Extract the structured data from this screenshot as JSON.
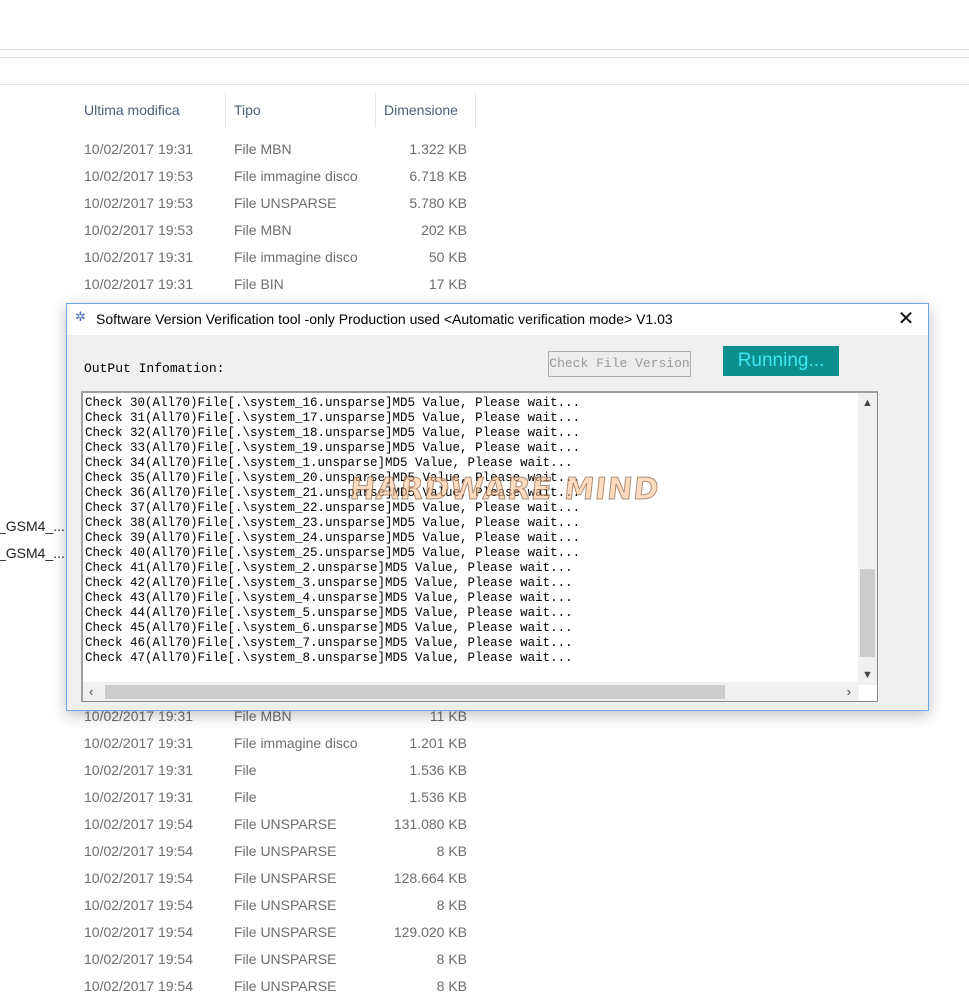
{
  "explorer": {
    "columns": {
      "date": "Ultima modifica",
      "type": "Tipo",
      "size": "Dimensione"
    },
    "name_fragments": [
      "_GSM4_...",
      "_GSM4_..."
    ],
    "rows_top": [
      {
        "date": "10/02/2017 19:31",
        "type": "File MBN",
        "size": "1.322 KB"
      },
      {
        "date": "10/02/2017 19:53",
        "type": "File immagine disco",
        "size": "6.718 KB"
      },
      {
        "date": "10/02/2017 19:53",
        "type": "File UNSPARSE",
        "size": "5.780 KB"
      },
      {
        "date": "10/02/2017 19:53",
        "type": "File MBN",
        "size": "202 KB"
      },
      {
        "date": "10/02/2017 19:31",
        "type": "File immagine disco",
        "size": "50 KB"
      },
      {
        "date": "10/02/2017 19:31",
        "type": "File BIN",
        "size": "17 KB"
      }
    ],
    "rows_bottom": [
      {
        "date": "10/02/2017 19:31",
        "type": "File MBN",
        "size": "11 KB"
      },
      {
        "date": "10/02/2017 19:31",
        "type": "File immagine disco",
        "size": "1.201 KB"
      },
      {
        "date": "10/02/2017 19:31",
        "type": "File",
        "size": "1.536 KB"
      },
      {
        "date": "10/02/2017 19:31",
        "type": "File",
        "size": "1.536 KB"
      },
      {
        "date": "10/02/2017 19:54",
        "type": "File UNSPARSE",
        "size": "131.080 KB"
      },
      {
        "date": "10/02/2017 19:54",
        "type": "File UNSPARSE",
        "size": "8 KB"
      },
      {
        "date": "10/02/2017 19:54",
        "type": "File UNSPARSE",
        "size": "128.664 KB"
      },
      {
        "date": "10/02/2017 19:54",
        "type": "File UNSPARSE",
        "size": "8 KB"
      },
      {
        "date": "10/02/2017 19:54",
        "type": "File UNSPARSE",
        "size": "129.020 KB"
      },
      {
        "date": "10/02/2017 19:54",
        "type": "File UNSPARSE",
        "size": "8 KB"
      },
      {
        "date": "10/02/2017 19:54",
        "type": "File UNSPARSE",
        "size": "8 KB"
      }
    ]
  },
  "dialog": {
    "title": "Software Version Verification tool -only Production used  <Automatic verification mode> V1.03",
    "close_label": "✕",
    "output_label": "OutPut Infomation:",
    "check_button": "Check File Version",
    "status": "Running...",
    "status_color": "#0b8f8f",
    "watermark": "HARDWARE MIND",
    "output_lines": [
      "Check 30(All70)File[.\\system_16.unsparse]MD5 Value, Please wait...",
      "Check 31(All70)File[.\\system_17.unsparse]MD5 Value, Please wait...",
      "Check 32(All70)File[.\\system_18.unsparse]MD5 Value, Please wait...",
      "Check 33(All70)File[.\\system_19.unsparse]MD5 Value, Please wait...",
      "Check 34(All70)File[.\\system_1.unsparse]MD5 Value, Please wait...",
      "Check 35(All70)File[.\\system_20.unsparse]MD5 Value, Please wait...",
      "Check 36(All70)File[.\\system_21.unsparse]MD5 Value, Please wait...",
      "Check 37(All70)File[.\\system_22.unsparse]MD5 Value, Please wait...",
      "Check 38(All70)File[.\\system_23.unsparse]MD5 Value, Please wait...",
      "Check 39(All70)File[.\\system_24.unsparse]MD5 Value, Please wait...",
      "Check 40(All70)File[.\\system_25.unsparse]MD5 Value, Please wait...",
      "Check 41(All70)File[.\\system_2.unsparse]MD5 Value, Please wait...",
      "Check 42(All70)File[.\\system_3.unsparse]MD5 Value, Please wait...",
      "Check 43(All70)File[.\\system_4.unsparse]MD5 Value, Please wait...",
      "Check 44(All70)File[.\\system_5.unsparse]MD5 Value, Please wait...",
      "Check 45(All70)File[.\\system_6.unsparse]MD5 Value, Please wait...",
      "Check 46(All70)File[.\\system_7.unsparse]MD5 Value, Please wait...",
      "Check 47(All70)File[.\\system_8.unsparse]MD5 Value, Please wait..."
    ]
  }
}
